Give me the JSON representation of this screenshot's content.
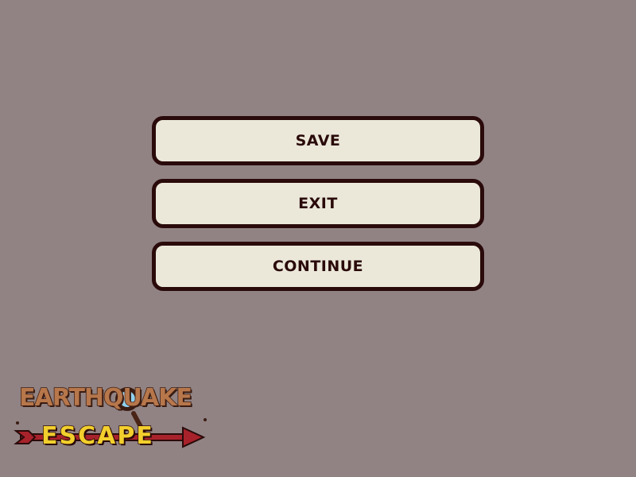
{
  "menu": {
    "save_label": "SAVE",
    "exit_label": "EXIT",
    "continue_label": "CONTINUE"
  },
  "logo": {
    "line1": "EARTHQUAKE",
    "line2": "ESCAPE",
    "icon": "magnifying-glass-icon"
  },
  "colors": {
    "background": "#918384",
    "button_fill": "#ebe8d9",
    "button_border": "#2a0a0a",
    "logo_brown": "#b7774b",
    "logo_yellow": "#f2cf2d",
    "logo_arrow": "#a8222b",
    "lens_blue": "#8fd0ef"
  }
}
